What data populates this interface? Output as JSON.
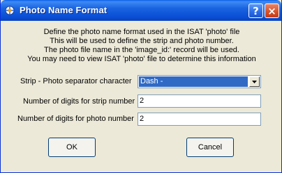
{
  "window": {
    "title": "Photo Name Format"
  },
  "description": [
    "Define the photo name format used in the ISAT 'photo' file",
    "This will be used to define the strip and photo number.",
    "The photo file name in the 'image_id:' record will be used.",
    "You may need to view ISAT 'photo' file to determine this information"
  ],
  "form": {
    "separator": {
      "label": "Strip - Photo separator character",
      "value": "Dash -"
    },
    "strip_digits": {
      "label": "Number of digits for strip number",
      "value": "2"
    },
    "photo_digits": {
      "label": "Number of digits for photo number",
      "value": "2"
    }
  },
  "buttons": {
    "ok": "OK",
    "cancel": "Cancel",
    "help": "?",
    "close": "×"
  }
}
